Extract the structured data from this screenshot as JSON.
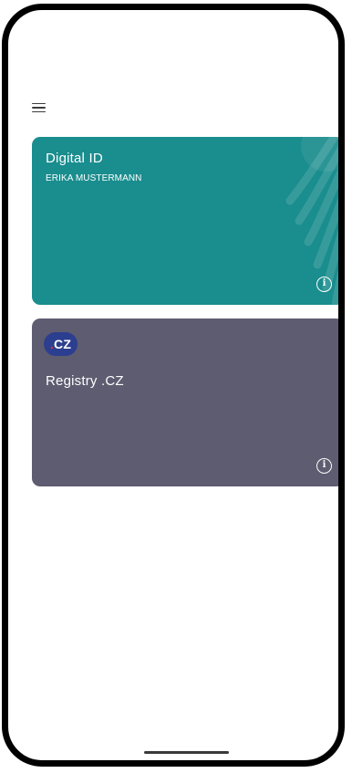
{
  "cards": {
    "digital_id": {
      "title": "Digital ID",
      "holder": "ERIKA MUSTERMANN",
      "info_glyph": "i",
      "color": "#1a8d8e"
    },
    "registry": {
      "logo_text": "CZ",
      "logo_dot": ".",
      "title": "Registry .CZ",
      "info_glyph": "i",
      "color": "#5e5c70"
    }
  },
  "icons": {
    "menu": "hamburger-menu-icon",
    "info": "info-icon",
    "watermark": "eagle-watermark-icon"
  }
}
